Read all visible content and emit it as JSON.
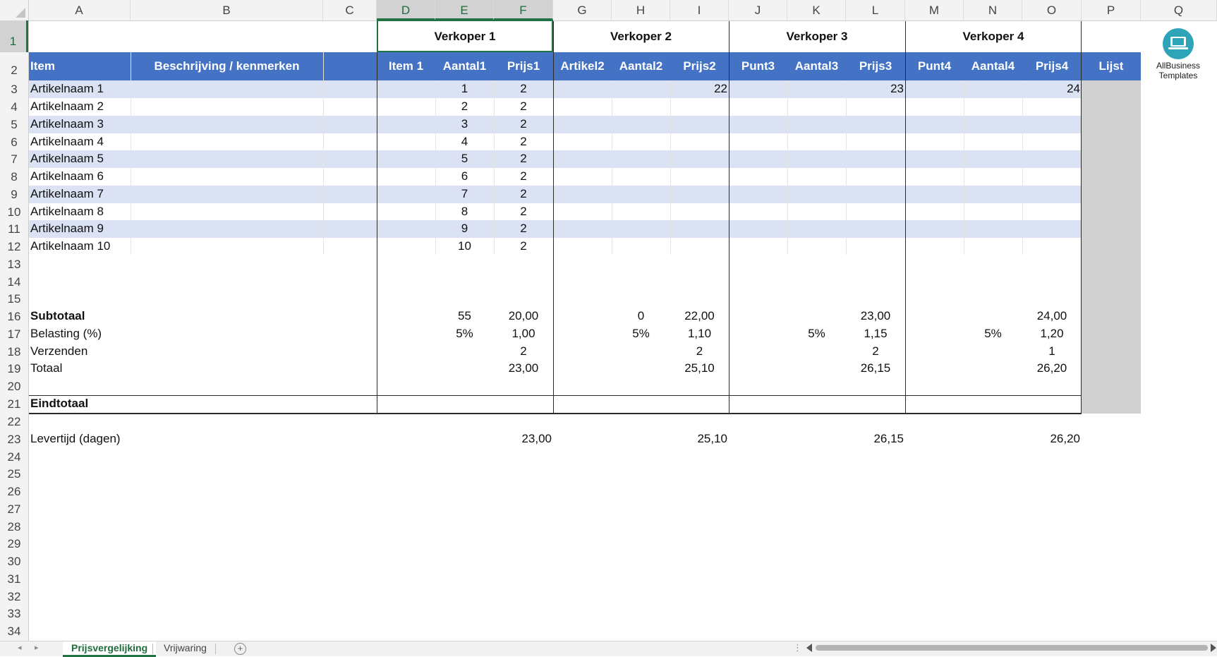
{
  "columns": [
    "A",
    "B",
    "C",
    "D",
    "E",
    "F",
    "G",
    "H",
    "I",
    "J",
    "K",
    "L",
    "M",
    "N",
    "O",
    "P",
    "Q"
  ],
  "rows": [
    "1",
    "2",
    "3",
    "4",
    "5",
    "6",
    "7",
    "8",
    "9",
    "10",
    "11",
    "12",
    "13",
    "14",
    "15",
    "16",
    "17",
    "18",
    "19",
    "20",
    "21",
    "22",
    "23",
    "24",
    "25",
    "26",
    "27",
    "28",
    "29",
    "30",
    "31",
    "32",
    "33",
    "34"
  ],
  "vendors": [
    "Verkoper 1",
    "Verkoper 2",
    "Verkoper 3",
    "Verkoper 4"
  ],
  "header": {
    "item": "Item",
    "desc": "Beschrijving / kenmerken",
    "cols": [
      "Item 1",
      "Aantal1",
      "Prijs1",
      "Artikel2",
      "Aantal2",
      "Prijs2",
      "Punt3",
      "Aantal3",
      "Prijs3",
      "Punt4",
      "Aantal4",
      "Prijs4"
    ],
    "list": "Lijst"
  },
  "items": [
    {
      "name": "Artikelnaam 1",
      "qty1": "1",
      "price1": "2",
      "price2": "22",
      "price3": "23",
      "price4": "24"
    },
    {
      "name": "Artikelnaam 2",
      "qty1": "2",
      "price1": "2"
    },
    {
      "name": "Artikelnaam 3",
      "qty1": "3",
      "price1": "2"
    },
    {
      "name": "Artikelnaam 4",
      "qty1": "4",
      "price1": "2"
    },
    {
      "name": "Artikelnaam 5",
      "qty1": "5",
      "price1": "2"
    },
    {
      "name": "Artikelnaam 6",
      "qty1": "6",
      "price1": "2"
    },
    {
      "name": "Artikelnaam 7",
      "qty1": "7",
      "price1": "2"
    },
    {
      "name": "Artikelnaam 8",
      "qty1": "8",
      "price1": "2"
    },
    {
      "name": "Artikelnaam 9",
      "qty1": "9",
      "price1": "2"
    },
    {
      "name": "Artikelnaam 10",
      "qty1": "10",
      "price1": "2"
    }
  ],
  "summary": {
    "subtotal_label": "Subtotaal",
    "tax_label": "Belasting (%)",
    "shipping_label": "Verzenden",
    "total_label": "Totaal",
    "grand_label": "Eindtotaal",
    "lead_label": "Levertijd (dagen)",
    "v1": {
      "sub_qty": "55",
      "sub": "20,00",
      "tax_pct": "5%",
      "tax": "1,00",
      "ship": "2",
      "total": "23,00",
      "lead": "23,00"
    },
    "v2": {
      "sub_qty": "0",
      "sub": "22,00",
      "tax_pct": "5%",
      "tax": "1,10",
      "ship": "2",
      "total": "25,10",
      "lead": "25,10"
    },
    "v3": {
      "sub": "23,00",
      "tax_pct": "5%",
      "tax": "1,15",
      "ship": "2",
      "total": "26,15",
      "lead": "26,15"
    },
    "v4": {
      "sub": "24,00",
      "tax_pct": "5%",
      "tax": "1,20",
      "ship": "1",
      "total": "26,20",
      "lead": "26,20"
    }
  },
  "logo": {
    "line1": "AllBusiness",
    "line2": "Templates"
  },
  "tabs": {
    "active": "Prijsvergelijking",
    "other": "Vrijwaring",
    "add": "+"
  },
  "nav": {
    "prev": "◂",
    "next": "▸",
    "dots": "⋮"
  },
  "colors": {
    "header_blue": "#4472c4",
    "band": "#dae2f3",
    "excel_green": "#217346",
    "gray_col": "#d0d0d0"
  }
}
